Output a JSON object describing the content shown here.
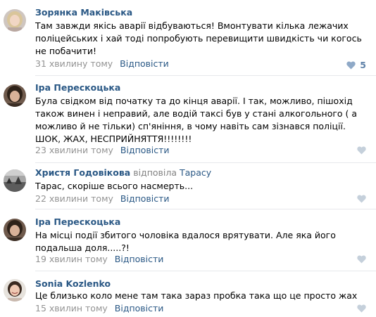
{
  "colors": {
    "author": "#2a5885",
    "link": "#2a5885",
    "time": "#939393",
    "text": "#000000",
    "like_active": "#5e81a8",
    "like_inactive": "#c5d0db",
    "divider": "#e7e8ec"
  },
  "comments": [
    {
      "author": "Зорянка Маківська",
      "text": "Там завжди якісь аварії відбуваються! Вмонтувати кілька лежачих поліцейських і хай тоді попробують перевищити швидкість чи когось не побачити!",
      "time": "31 хвилину тому",
      "reply_label": "Відповісти",
      "likes": "5",
      "avatar_icon": "avatar-photo-woman-blonde"
    },
    {
      "author": "Іра Перескоцька",
      "text": "Була свідком від початку та до кінця аварії. І так, можливо, пішохід також винен і неправий, але водій таксі був у стані алкогольного ( а можливо й не тільки) сп'яніння, в чому навіть сам зізнався поліції. ШОК, ЖАХ, НЕСПРИЙНЯТТЯ!!!!!!!!",
      "time": "23 хвилини тому",
      "reply_label": "Відповісти",
      "likes": "",
      "avatar_icon": "avatar-photo-woman-brunette"
    },
    {
      "author": "Христя Годовікова",
      "replied": "відповіла",
      "reply_to": "Тарасу",
      "text": "Тарас, скоріше всього насмерть...",
      "time": "22 хвилини тому",
      "reply_label": "Відповісти",
      "likes": "",
      "avatar_icon": "avatar-photo-landscape"
    },
    {
      "author": "Іра Перескоцька",
      "text": "На місці події збитого чоловіка вдалося врятувати. Але яка його подальша доля.....?!",
      "time": "19 хвилин тому",
      "reply_label": "Відповісти",
      "likes": "",
      "avatar_icon": "avatar-photo-woman-brunette"
    },
    {
      "author": "Sonia Kozlenko",
      "text": "Це близько коло мене там така зараз пробка така що це просто жах",
      "time": "15 хвилин тому",
      "reply_label": "Відповісти",
      "likes": "",
      "avatar_icon": "avatar-photo-woman-smiling"
    }
  ]
}
